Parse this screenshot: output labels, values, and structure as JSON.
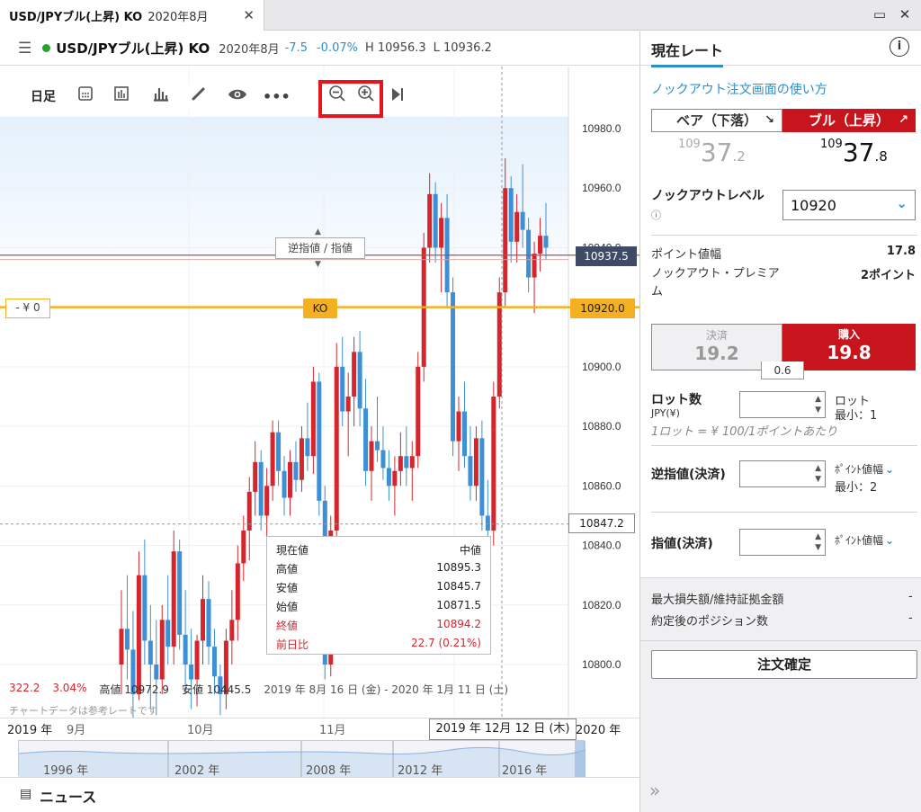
{
  "tab": {
    "title": "USD/JPYブル(上昇) KO",
    "subtitle": "2020年8月"
  },
  "info": {
    "symbol": "USD/JPYブル(上昇) KO",
    "month": "2020年8月",
    "change": "-7.5",
    "change_pct": "-0.07%",
    "high": "H 10956.3",
    "low": "L 10936.2"
  },
  "toolbar": {
    "interval": "日足"
  },
  "chart": {
    "price_label": "10937.5",
    "ko_level_label": "10920.0",
    "crosshair_label": "10847.2",
    "ko_badge": "KO",
    "yen_zero": "- ¥ 0",
    "stop_limit_label": "逆指値 / 指値",
    "x_labels": [
      "2019 年",
      "9月",
      "10月",
      "11月",
      "2020 年"
    ],
    "crosshair_date": "2019 年 12月 12 日 (木)",
    "range_labels": [
      "1996 年",
      "2002 年",
      "2008 年",
      "2012 年",
      "2016 年"
    ],
    "stats": {
      "change": "322.2",
      "pct": "3.04%",
      "high": "高値 10972.9",
      "low": "安値 10445.5",
      "range": "2019 年 8月 16 日 (金) - 2020 年 1月 11 日 (土)"
    },
    "note": "チャートデータは参考レートです",
    "tooltip": {
      "header_l": "現在値",
      "header_r": "中値",
      "rows": [
        {
          "k": "高値",
          "v": "10895.3",
          "red": false
        },
        {
          "k": "安値",
          "v": "10845.7",
          "red": false
        },
        {
          "k": "始値",
          "v": "10871.5",
          "red": false
        },
        {
          "k": "終値",
          "v": "10894.2",
          "red": true
        },
        {
          "k": "前日比",
          "v": "22.7 (0.21%)",
          "red": true
        }
      ]
    }
  },
  "chart_data": {
    "type": "candlestick",
    "y_ticks": [
      10980.0,
      10960.0,
      10940.0,
      10920.0,
      10900.0,
      10880.0,
      10860.0,
      10840.0,
      10820.0,
      10800.0
    ],
    "ylim": [
      10783,
      10984
    ],
    "ohlc": [
      [
        10800,
        10825,
        10790,
        10812
      ],
      [
        10812,
        10830,
        10795,
        10805
      ],
      [
        10805,
        10818,
        10782,
        10790
      ],
      [
        10790,
        10838,
        10788,
        10830
      ],
      [
        10830,
        10842,
        10800,
        10808
      ],
      [
        10808,
        10820,
        10785,
        10800
      ],
      [
        10800,
        10815,
        10783,
        10795
      ],
      [
        10795,
        10820,
        10790,
        10815
      ],
      [
        10815,
        10830,
        10800,
        10806
      ],
      [
        10806,
        10845,
        10800,
        10838
      ],
      [
        10838,
        10842,
        10805,
        10810
      ],
      [
        10810,
        10825,
        10790,
        10800
      ],
      [
        10800,
        10812,
        10785,
        10795
      ],
      [
        10795,
        10810,
        10786,
        10808
      ],
      [
        10808,
        10830,
        10800,
        10822
      ],
      [
        10822,
        10828,
        10800,
        10806
      ],
      [
        10806,
        10812,
        10790,
        10796
      ],
      [
        10796,
        10800,
        10783,
        10790
      ],
      [
        10790,
        10812,
        10785,
        10808
      ],
      [
        10808,
        10825,
        10800,
        10815
      ],
      [
        10815,
        10840,
        10808,
        10834
      ],
      [
        10834,
        10850,
        10828,
        10845
      ],
      [
        10845,
        10863,
        10835,
        10858
      ],
      [
        10858,
        10875,
        10850,
        10868
      ],
      [
        10868,
        10872,
        10845,
        10850
      ],
      [
        10850,
        10866,
        10842,
        10860
      ],
      [
        10860,
        10882,
        10855,
        10878
      ],
      [
        10878,
        10882,
        10860,
        10865
      ],
      [
        10865,
        10870,
        10850,
        10856
      ],
      [
        10856,
        10872,
        10850,
        10868
      ],
      [
        10868,
        10875,
        10858,
        10862
      ],
      [
        10862,
        10880,
        10858,
        10876
      ],
      [
        10876,
        10888,
        10865,
        10870
      ],
      [
        10870,
        10900,
        10864,
        10895
      ],
      [
        10895,
        10898,
        10850,
        10855
      ],
      [
        10855,
        10860,
        10795,
        10800
      ],
      [
        10800,
        10850,
        10796,
        10845
      ],
      [
        10845,
        10908,
        10840,
        10900
      ],
      [
        10900,
        10910,
        10880,
        10885
      ],
      [
        10885,
        10898,
        10870,
        10890
      ],
      [
        10890,
        10910,
        10880,
        10905
      ],
      [
        10905,
        10912,
        10880,
        10886
      ],
      [
        10886,
        10896,
        10860,
        10865
      ],
      [
        10865,
        10880,
        10855,
        10875
      ],
      [
        10875,
        10890,
        10868,
        10872
      ],
      [
        10872,
        10880,
        10862,
        10866
      ],
      [
        10866,
        10872,
        10855,
        10860
      ],
      [
        10860,
        10870,
        10850,
        10865
      ],
      [
        10865,
        10878,
        10860,
        10870
      ],
      [
        10870,
        10880,
        10860,
        10866
      ],
      [
        10866,
        10875,
        10855,
        10870
      ],
      [
        10870,
        10905,
        10866,
        10900
      ],
      [
        10900,
        10945,
        10895,
        10940
      ],
      [
        10940,
        10965,
        10935,
        10958
      ],
      [
        10958,
        10962,
        10935,
        10940
      ],
      [
        10940,
        10955,
        10925,
        10950
      ],
      [
        10950,
        10958,
        10920,
        10925
      ],
      [
        10925,
        10930,
        10870,
        10875
      ],
      [
        10875,
        10890,
        10865,
        10885
      ],
      [
        10885,
        10895,
        10866,
        10870
      ],
      [
        10870,
        10880,
        10855,
        10860
      ],
      [
        10860,
        10880,
        10855,
        10876
      ],
      [
        10876,
        10882,
        10845,
        10850
      ],
      [
        10850,
        10862,
        10840,
        10845
      ],
      [
        10845,
        10895,
        10840,
        10890
      ],
      [
        10890,
        10930,
        10886,
        10925
      ],
      [
        10925,
        10970,
        10920,
        10960
      ],
      [
        10960,
        10964,
        10935,
        10942
      ],
      [
        10942,
        10958,
        10935,
        10952
      ],
      [
        10952,
        10968,
        10940,
        10946
      ],
      [
        10946,
        10950,
        10925,
        10930
      ],
      [
        10930,
        10942,
        10918,
        10938
      ],
      [
        10938,
        10950,
        10932,
        10944
      ],
      [
        10944,
        10955,
        10936,
        10940
      ]
    ]
  },
  "panel": {
    "title": "現在レート",
    "howto": "ノックアウト注文画面の使い方",
    "bear_label": "ベア（下落）",
    "bull_label": "ブル（上昇）",
    "bear_price_big": "10937",
    "bear_price_small": "109",
    "bear_price_int": "37",
    "bear_price_dec": ".2",
    "bull_price_small": "109",
    "bull_price_int": "37",
    "bull_price_dec": ".8",
    "ko_level_label": "ノックアウトレベル",
    "ko_level_value": "10920",
    "point_width_label": "ポイント値幅",
    "point_width_value": "17.8",
    "premium_label": "ノックアウト・プレミアム",
    "premium_value": "2ポイント",
    "settle_label": "決済",
    "settle_value": "19.2",
    "buy_label": "購入",
    "buy_value": "19.8",
    "spread": "0.6",
    "lot_label": "ロット数",
    "lot_sub": "JPY(¥)",
    "lot_unit": "ロット",
    "lot_min": "最小：1",
    "lot_note": "1ロット = ¥ 100/1ポイントあたり",
    "stop_label": "逆指値(決済)",
    "stop_unit": "ﾎﾟｲﾝﾄ値幅",
    "stop_min": "最小：2",
    "limit_label": "指値(決済)",
    "limit_unit": "ﾎﾟｲﾝﾄ値幅",
    "max_loss_label": "最大損失額/維持証拠金額",
    "max_loss_value": "-",
    "positions_label": "約定後のポジション数",
    "positions_value": "-",
    "confirm": "注文確定"
  },
  "footer": {
    "news": "ニュース"
  },
  "colors": {
    "bull": "#d4262c",
    "bear": "#3d8fd6",
    "ko": "#f5b021",
    "price_line": "#b94a4a",
    "accent": "#2b8fc9"
  }
}
